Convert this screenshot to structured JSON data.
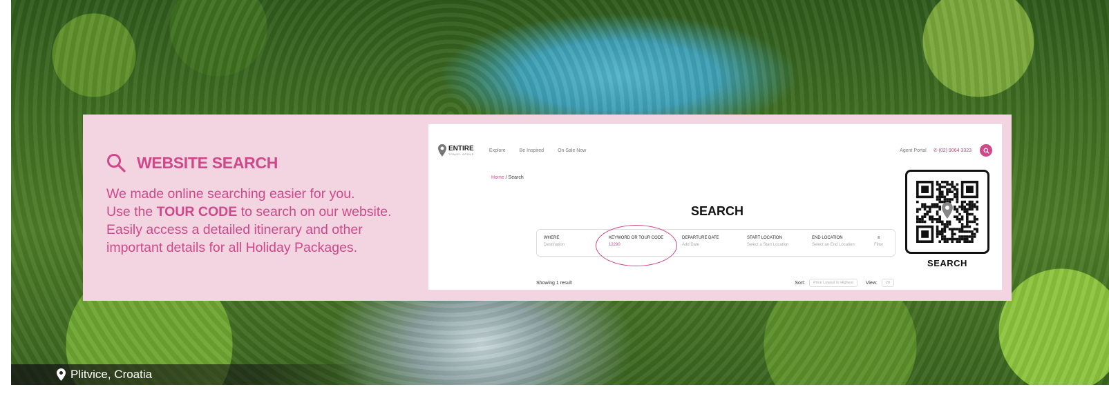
{
  "location": {
    "text": "Plitvice, Croatia"
  },
  "promo": {
    "title": "WEBSITE SEARCH",
    "line1": "We made online searching easier for you.",
    "line2_pre": "Use the ",
    "line2_bold": "TOUR CODE",
    "line2_post": " to search on our website.",
    "line3": "Easily access a detailed itinerary and other",
    "line4": "important details for all Holiday Packages."
  },
  "screenshot": {
    "logo_text": "ENTIRE",
    "logo_sub": "TRAVEL GROUP",
    "nav": [
      "Explore",
      "Be Inspired",
      "On Sale Now"
    ],
    "agent_portal": "Agent Portal",
    "phone": "(02) 9064 3323",
    "breadcrumb_home": "Home",
    "breadcrumb_sep": " / ",
    "breadcrumb_current": "Search",
    "heading": "SEARCH",
    "fields": [
      {
        "label": "WHERE",
        "value": "Destination"
      },
      {
        "label": "KEYWORD OR TOUR CODE",
        "value": "12290"
      },
      {
        "label": "DEPARTURE DATE",
        "value": "Add Date"
      },
      {
        "label": "START LOCATION",
        "value": "Select a Start Location"
      },
      {
        "label": "END LOCATION",
        "value": "Select an End Location"
      }
    ],
    "filter_label": "Filter",
    "results": "Showing 1 result",
    "sort_label": "Sort:",
    "sort_value": "Price Lowest to Highest",
    "view_label": "View:",
    "view_value": "20"
  },
  "qr": {
    "label": "SEARCH"
  },
  "colors": {
    "accent": "#d0478a",
    "panel": "#f2d5e1"
  }
}
